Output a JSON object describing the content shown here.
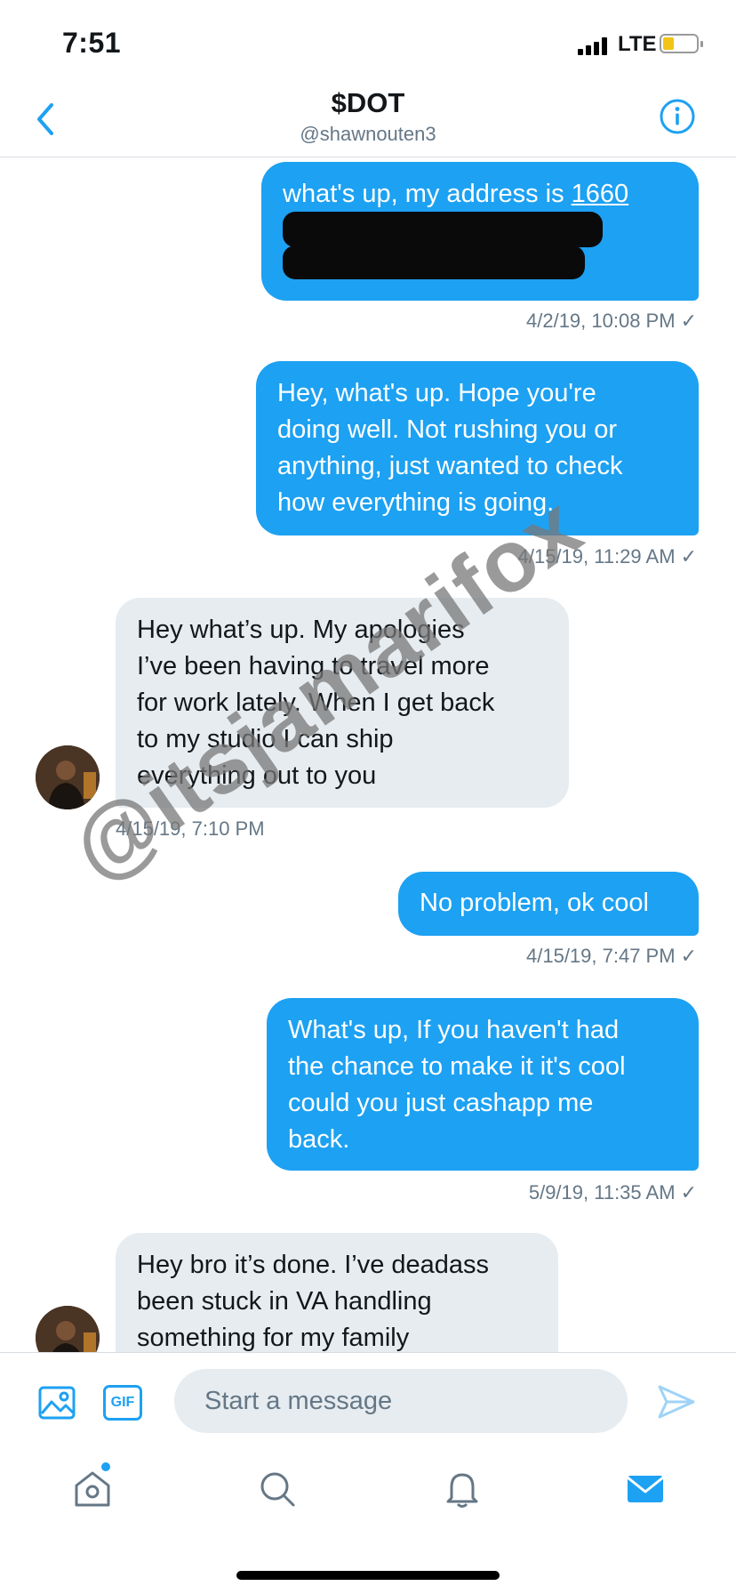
{
  "status_bar": {
    "time": "7:51",
    "network": "LTE"
  },
  "header": {
    "title": "$DOT",
    "handle": "@shawnouten3"
  },
  "messages": [
    {
      "direction": "outgoing",
      "lines": [
        "what's up, my address is 1660"
      ],
      "redacted": true,
      "timestamp": "4/2/19, 10:08 PM"
    },
    {
      "direction": "outgoing",
      "lines": [
        "Hey, what's up. Hope you're",
        "doing well. Not rushing you or",
        "anything, just wanted to check",
        "how everything is going."
      ],
      "timestamp": "4/15/19, 11:29 AM"
    },
    {
      "direction": "incoming",
      "lines": [
        "Hey what’s up. My apologies",
        "I’ve been having to travel more",
        "for work lately. When I get back",
        "to my studio I can ship",
        "everything out to you"
      ],
      "timestamp": "4/15/19, 7:10 PM"
    },
    {
      "direction": "outgoing",
      "lines": [
        "No problem, ok cool"
      ],
      "timestamp": "4/15/19, 7:47 PM"
    },
    {
      "direction": "outgoing",
      "lines": [
        "What's up, If you haven't had",
        "the chance to make it it's cool",
        "could you just cashapp me",
        "back."
      ],
      "timestamp": "5/9/19, 11:35 AM"
    },
    {
      "direction": "incoming",
      "lines": [
        "Hey bro it’s done. I’ve deadass",
        "been stuck in VA handling",
        "something for my family"
      ]
    }
  ],
  "watermark": "@itsjamarifox",
  "composer": {
    "placeholder": "Start a message",
    "gif_label": "GIF"
  },
  "tabs": [
    "home-icon",
    "search-icon",
    "notifications-icon",
    "messages-icon"
  ],
  "colors": {
    "accent": "#1da1f2",
    "incoming_bubble": "#e6ecf0",
    "meta_text": "#657786"
  },
  "checkmark": "✓"
}
